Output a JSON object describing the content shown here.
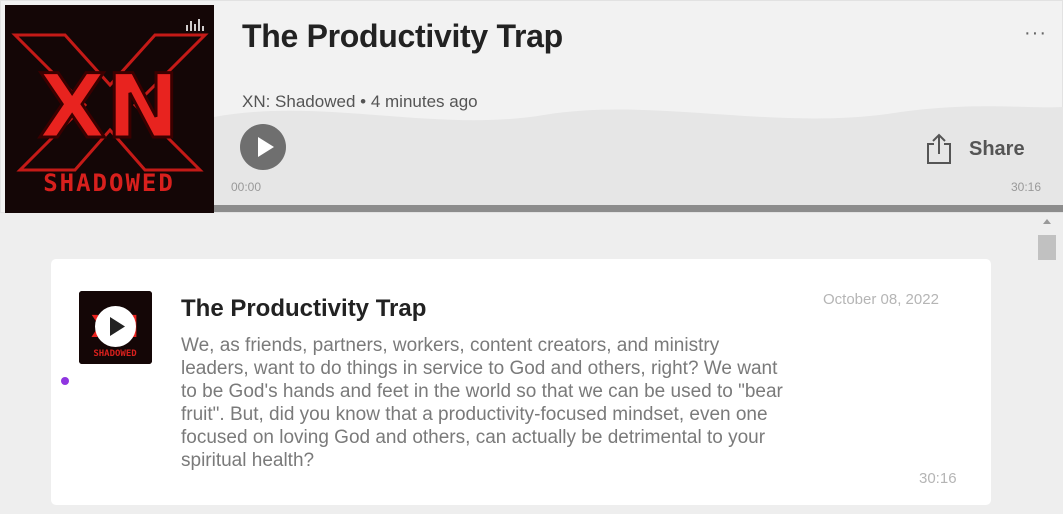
{
  "player": {
    "title": "The Productivity Trap",
    "show_name": "XN: Shadowed",
    "separator": "•",
    "published_ago": "4 minutes ago",
    "more_label": "···",
    "share_label": "Share",
    "time_current": "00:00",
    "time_total": "30:16",
    "progress_fraction": 0,
    "cover_text_top": "XN",
    "cover_text_bottom": "SHADOWED"
  },
  "episode": {
    "title": "The Productivity Trap",
    "date": "October 08, 2022",
    "description": "We, as friends, partners, workers, content creators, and ministry leaders, want to do things in service to God and others, right? We want to be God's hands and feet in the world so that we can be used to \"bear fruit\". But, did you know that a productivity-focused mindset, even one focused on loving God and others, can actually be detrimental to your spiritual health?",
    "duration": "30:16",
    "unplayed": true
  },
  "icons": {
    "cover_badge": "anchor-podcast-icon",
    "play": "play-icon",
    "share": "share-icon",
    "more": "more-icon"
  },
  "colors": {
    "unplayed_dot": "#8f35e0",
    "play_button": "#6f6f6f",
    "cover_red": "#e8231f"
  }
}
